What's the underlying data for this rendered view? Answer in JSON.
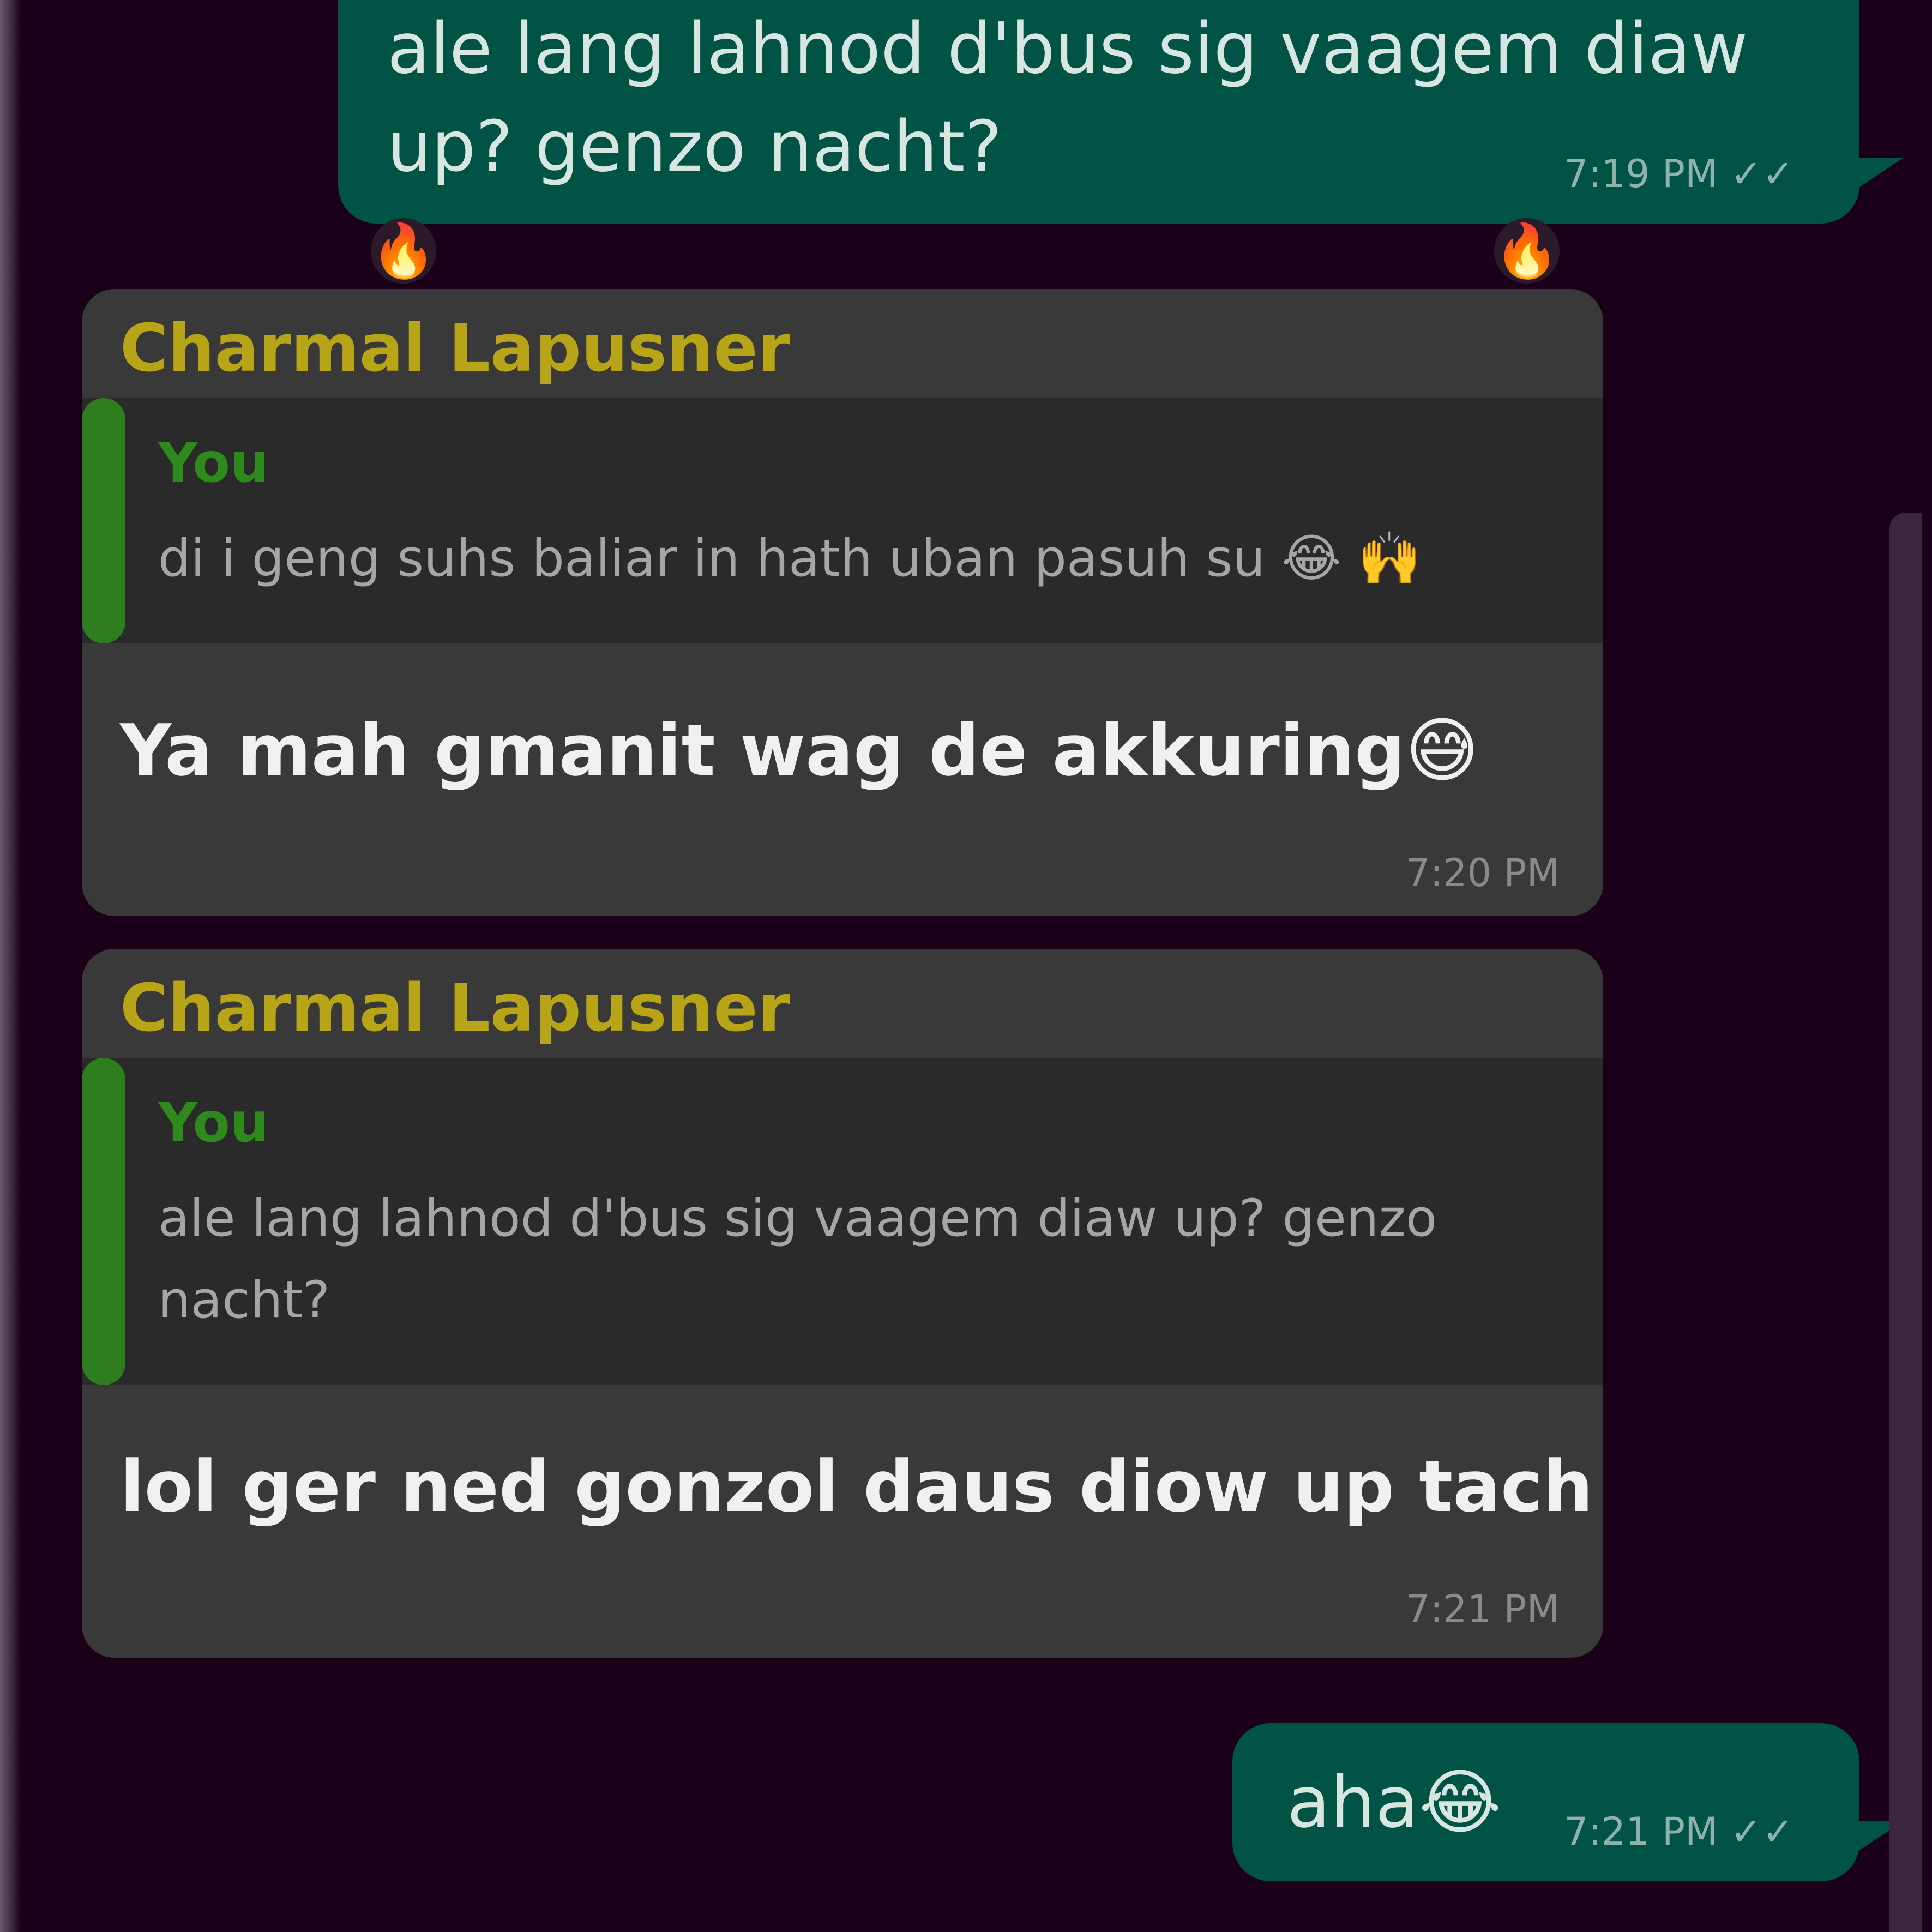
{
  "colors": {
    "background": "#1a0019",
    "outgoing_bubble": "#005345",
    "incoming_bubble": "#393939",
    "quote_background": "#2a2a2a",
    "quote_bar": "#2e7d1f",
    "sender_name": "#b8a417"
  },
  "chat": {
    "top_outgoing": {
      "text": "ale lang lahnod d'bus sig vaagem diaw up? genzo nacht?",
      "meta": "7:19 PM ✓✓"
    },
    "reactions": [
      "🔥",
      "🔥"
    ],
    "incoming_1": {
      "sender": "Charmal Lapusner",
      "quote_author": "You",
      "quote_text": "di i geng suhs baliar in hath uban pasuh su 😂 🙌",
      "text": "Ya mah gmanit wag de akkuring😅",
      "time": "7:20 PM"
    },
    "incoming_2": {
      "sender": "Charmal Lapusner",
      "quote_author": "You",
      "quote_text": "ale lang lahnod d'bus sig vaagem diaw up? genzo nacht?",
      "text": "lol ger ned gonzol daus diow up tach",
      "time": "7:21 PM"
    },
    "bottom_outgoing": {
      "text": "aha😂",
      "meta": "7:21 PM ✓✓"
    }
  }
}
